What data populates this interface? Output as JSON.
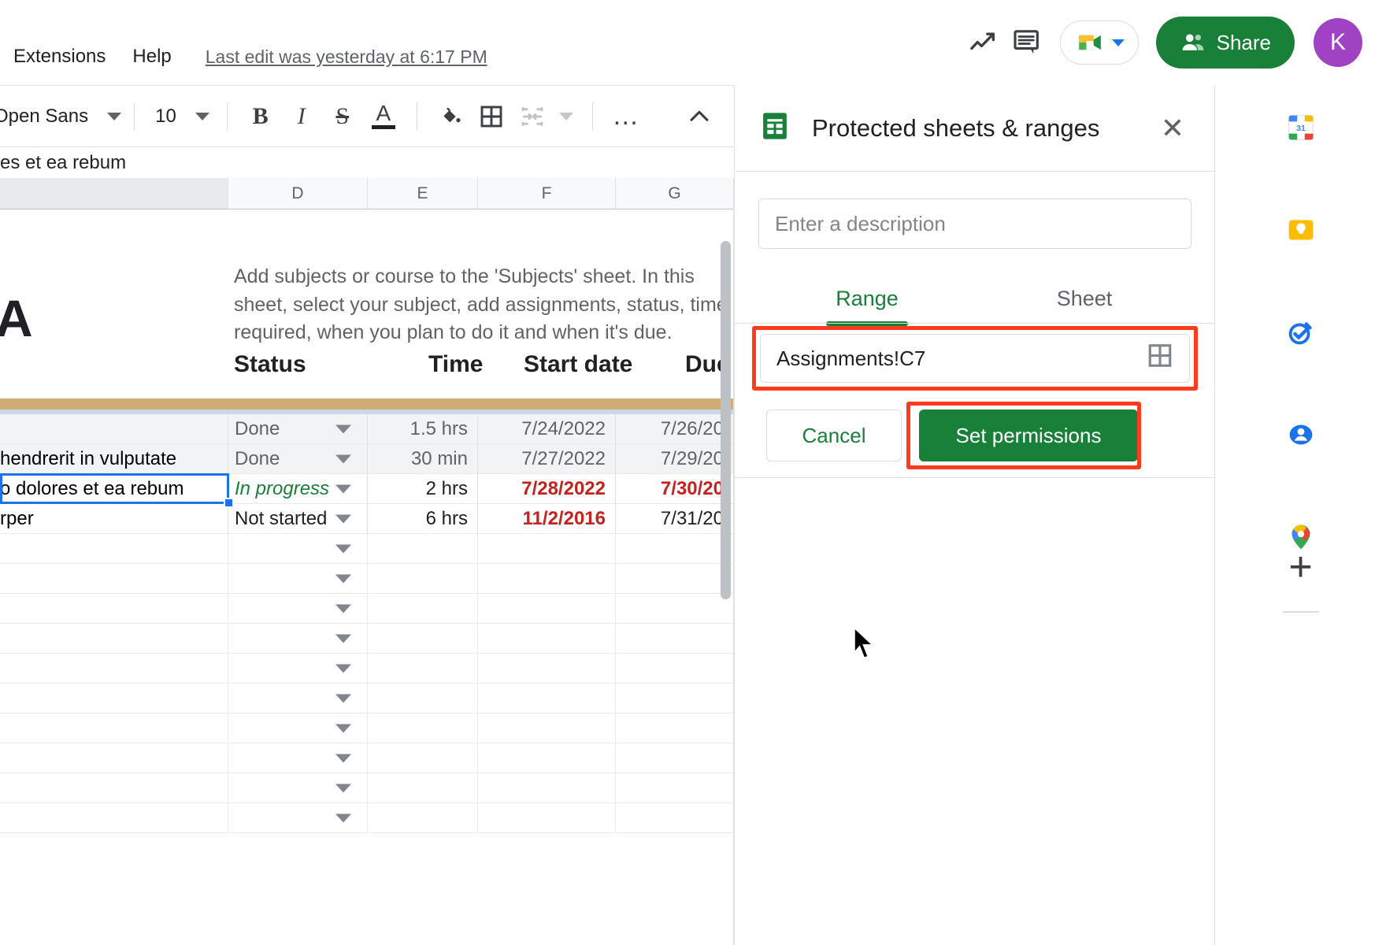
{
  "menu": {
    "items": [
      "Extensions",
      "Help"
    ],
    "last_edit": "Last edit was yesterday at 6:17 PM"
  },
  "top_right": {
    "trending_icon": "trending-up-icon",
    "comment_icon": "comment-icon",
    "meet_icon": "google-meet-icon",
    "share_label": "Share",
    "avatar_letter": "K"
  },
  "toolbar": {
    "font_name": "Open Sans",
    "font_size": "10",
    "bold": "B",
    "italic": "I",
    "strikethrough": "S",
    "text_color": "A",
    "fill_color": "fill-color-icon",
    "borders": "borders-icon",
    "merge_cells": "merge-cells-icon",
    "more": "…",
    "collapse": "collapse-toolbar-icon"
  },
  "formula_bar": {
    "value": "es et ea rebum"
  },
  "grid": {
    "columns": [
      "D",
      "E",
      "F",
      "G"
    ],
    "instruction": "Add subjects or course to the 'Subjects' sheet. In this sheet, select your subject, add assignments, status, time required, when you plan to do it and when it's due.",
    "big_letter": "A",
    "headers": [
      "Status",
      "Time",
      "Start date",
      "Due"
    ],
    "rows": [
      {
        "task": "",
        "status": "Done",
        "time": "1.5 hrs",
        "start": "7/24/2022",
        "due": "7/26/20",
        "shaded": true,
        "status_style": "grey",
        "date_style": "grey"
      },
      {
        "task": "hendrerit in vulputate",
        "status": "Done",
        "time": "30 min",
        "start": "7/27/2022",
        "due": "7/29/20",
        "shaded": true,
        "status_style": "grey",
        "date_style": "grey"
      },
      {
        "task": "o dolores et ea rebum",
        "status": "In progress",
        "time": "2 hrs",
        "start": "7/28/2022",
        "due": "7/30/20",
        "shaded": false,
        "status_style": "green-italic",
        "date_style": "red-bold"
      },
      {
        "task": "rper",
        "status": "Not started",
        "time": "6 hrs",
        "start": "11/2/2016",
        "due": "7/31/20",
        "shaded": false,
        "status_style": "dark",
        "date_style": "mixed"
      }
    ],
    "empty_row_count": 10,
    "dropdown_icon": "dropdown-arrow-icon"
  },
  "panel": {
    "icon": "sheets-icon",
    "title": "Protected sheets & ranges",
    "close_icon": "close-icon",
    "description_placeholder": "Enter a description",
    "tabs": [
      {
        "label": "Range",
        "active": true
      },
      {
        "label": "Sheet",
        "active": false
      }
    ],
    "range_value": "Assignments!C7",
    "range_picker_icon": "select-data-range-icon",
    "cancel_label": "Cancel",
    "set_permissions_label": "Set permissions",
    "highlight_color": "#ff3b1f"
  },
  "rail": {
    "items": [
      {
        "name": "google-calendar-icon",
        "label": "31"
      },
      {
        "name": "google-keep-icon",
        "label": ""
      },
      {
        "name": "google-tasks-icon",
        "label": ""
      },
      {
        "name": "google-contacts-icon",
        "label": ""
      },
      {
        "name": "google-maps-icon",
        "label": ""
      }
    ],
    "add_label": "+"
  },
  "colors": {
    "brand_green": "#188038",
    "accent_blue": "#1a73e8",
    "annotation_red": "#ff3b1f",
    "header_gold": "#ceac73",
    "avatar_purple": "#a142c5"
  }
}
